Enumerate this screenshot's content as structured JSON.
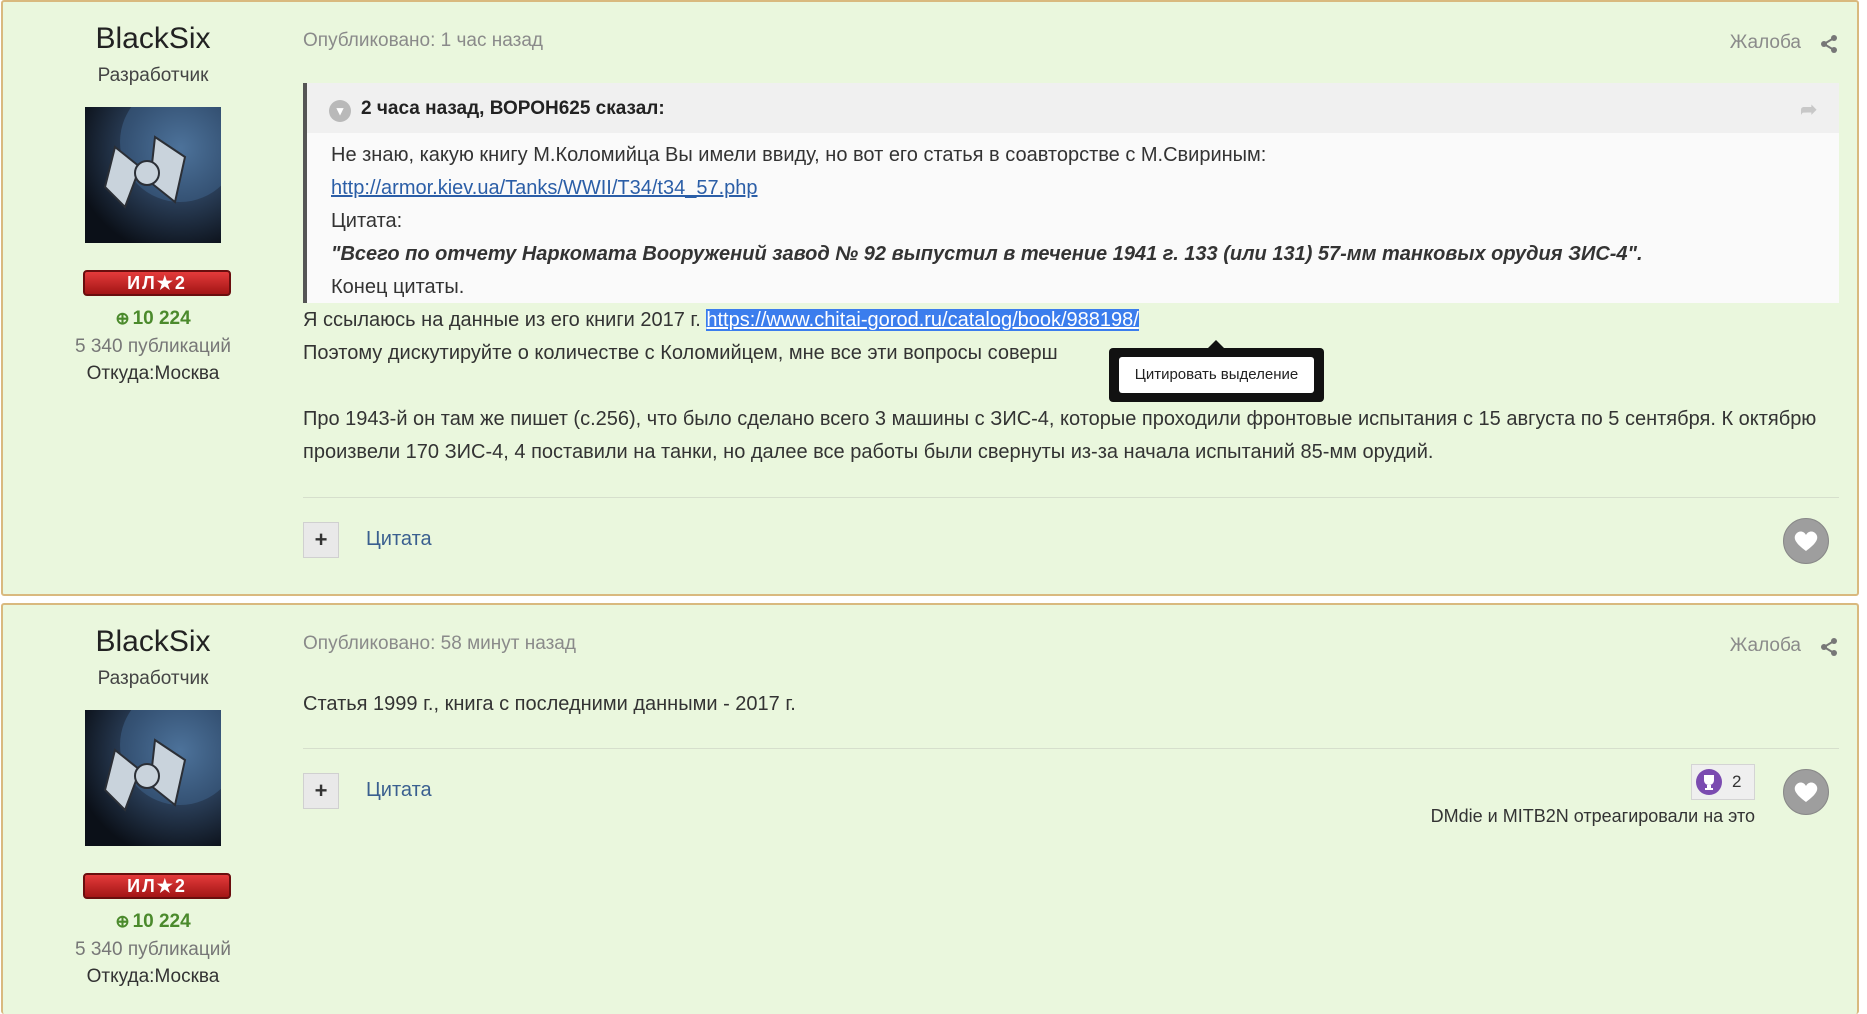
{
  "posts": [
    {
      "author": "BlackSix",
      "role": "Разработчик",
      "rank": "ИЛ★2",
      "reputation": "10 224",
      "posts_count": "5 340 публикаций",
      "location": "Откуда:Москва",
      "published": "Опубликовано: 1 час назад",
      "report": "Жалоба",
      "quote": {
        "citation": "2 часа назад, ВОРОН625 сказал:",
        "line1": "Не знаю, какую книгу М.Коломийца Вы имели ввиду, но вот его статья в соавторстве с М.Свириным:",
        "link": "http://armor.kiev.ua/Tanks/WWII/T34/t34_57.php",
        "line3": "Цитата:",
        "line4": "\"Всего по отчету Наркомата Вооружений завод № 92 выпустил в течение 1941 г. 133 (или 131) 57-мм танковых орудия ЗИС-4\".",
        "line5": "Конец цитаты."
      },
      "body_line1_text": "Я ссылаюсь на данные из его книги 2017 г. ",
      "body_line1_link": "https://www.chitai-gorod.ru/catalog/book/988198/",
      "body_line2": "Поэтому дискутируйте о количестве с Коломийцем, мне все эти вопросы соверш",
      "body_para2": "Про 1943-й он там же пишет (с.256), что было сделано всего 3 машины с ЗИС-4, которые проходили фронтовые испытания с 15 августа по 5 сентября. К октябрю произвели 170 ЗИС-4, 4 поставили на танки, но далее все работы были свернуты из-за начала испытаний 85-мм орудий.",
      "plus": "+",
      "cite_btn": "Цитата"
    },
    {
      "author": "BlackSix",
      "role": "Разработчик",
      "rank": "ИЛ★2",
      "reputation": "10 224",
      "posts_count": "5 340 публикаций",
      "location": "Откуда:Москва",
      "published": "Опубликовано: 58 минут назад",
      "report": "Жалоба",
      "body": "Статья 1999 г., книга с последними данными - 2017 г.",
      "plus": "+",
      "cite_btn": "Цитата",
      "reaction_count": "2",
      "reacted_text": "DMdie и MITB2N отреагировали на это"
    }
  ],
  "tooltip": {
    "label": "Цитировать выделение"
  },
  "icons": {
    "rep": "plus-circle-icon",
    "share": "share-icon",
    "like": "heart-icon",
    "reaction": "trophy-icon",
    "quote_toggle": "chevron-down-icon",
    "quote_jump": "arrow-share-icon"
  },
  "colors": {
    "post_bg": "#eaf7dd",
    "post_border": "#d9b97e",
    "link": "#2b5ea7",
    "selection": "#3b7ded",
    "reputation": "#4b8a2c"
  }
}
